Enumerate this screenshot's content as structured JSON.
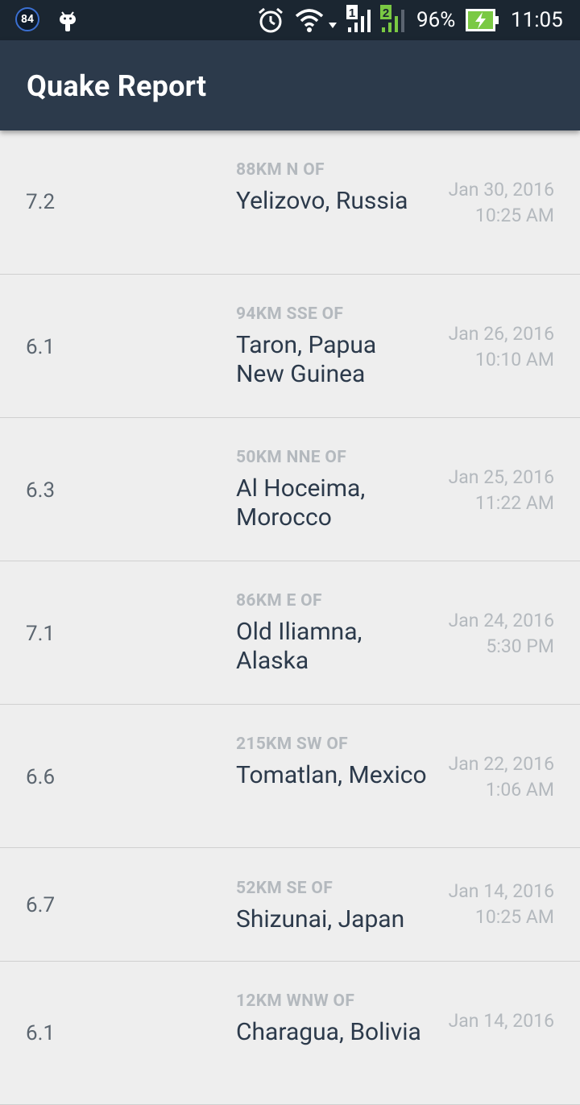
{
  "status_bar": {
    "badge_text": "84",
    "battery_percent": "96%",
    "time": "11:05",
    "sim1_label": "1",
    "sim2_label": "2",
    "icons": [
      "notification-badge-icon",
      "android-icon",
      "alarm-icon",
      "wifi-icon",
      "signal-sim1-icon",
      "signal-sim2-icon",
      "battery-charging-icon"
    ]
  },
  "app_bar": {
    "title": "Quake Report"
  },
  "quakes": [
    {
      "magnitude": "7.2",
      "offset": "88KM N OF",
      "location": "Yelizovo, Russia",
      "date": "Jan 30, 2016",
      "time": "10:25 AM"
    },
    {
      "magnitude": "6.1",
      "offset": "94KM SSE OF",
      "location": "Taron, Papua New Guinea",
      "date": "Jan 26, 2016",
      "time": "10:10 AM"
    },
    {
      "magnitude": "6.3",
      "offset": "50KM NNE OF",
      "location": "Al Hoceima, Morocco",
      "date": "Jan 25, 2016",
      "time": "11:22 AM"
    },
    {
      "magnitude": "7.1",
      "offset": "86KM E OF",
      "location": "Old Iliamna, Alaska",
      "date": "Jan 24, 2016",
      "time": "5:30 PM"
    },
    {
      "magnitude": "6.6",
      "offset": "215KM SW OF",
      "location": "Tomatlan, Mexico",
      "date": "Jan 22, 2016",
      "time": "1:06 AM"
    },
    {
      "magnitude": "6.7",
      "offset": "52KM SE OF",
      "location": "Shizunai, Japan",
      "date": "Jan 14, 2016",
      "time": "10:25 AM"
    },
    {
      "magnitude": "6.1",
      "offset": "12KM WNW OF",
      "location": "Charagua, Bolivia",
      "date": "Jan 14, 2016",
      "time": ""
    }
  ],
  "colors": {
    "status_bar": "#1b2631",
    "app_bar": "#2c3a4b",
    "background": "#eeeeee",
    "magnitude_text": "#5c6670",
    "secondary_text": "#b4b9be",
    "primary_text": "#2c3a4b"
  }
}
